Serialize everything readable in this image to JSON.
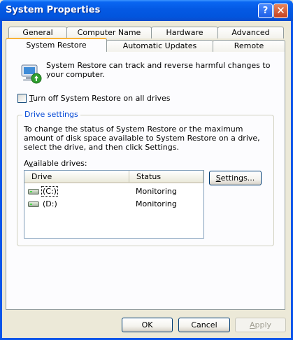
{
  "window": {
    "title": "System Properties",
    "help_glyph": "?",
    "close_glyph": "✕"
  },
  "tabs": {
    "row1": [
      "General",
      "Computer Name",
      "Hardware",
      "Advanced"
    ],
    "row2": [
      "System Restore",
      "Automatic Updates",
      "Remote"
    ],
    "active": "System Restore"
  },
  "content": {
    "description": "System Restore can track and reverse harmful changes to your computer.",
    "turn_off": {
      "label_mnemonic": "T",
      "label_rest": "urn off System Restore on all drives",
      "checked": false
    },
    "group_title": "Drive settings",
    "instructions": "To change the status of System Restore or the maximum amount of disk space available to System Restore on a drive, select the drive, and then click Settings.",
    "available_pre": "A",
    "available_mnemonic": "v",
    "available_rest": "ailable drives:",
    "columns": [
      "Drive",
      "Status"
    ],
    "drives": [
      {
        "name": "(C:)",
        "status": "Monitoring",
        "icon": "hard-drive-icon",
        "selected": true
      },
      {
        "name": "(D:)",
        "status": "Monitoring",
        "icon": "hard-drive-icon",
        "selected": false
      }
    ],
    "settings_mnemonic": "S",
    "settings_rest": "ettings..."
  },
  "buttons": {
    "ok": "OK",
    "cancel": "Cancel",
    "apply_mnemonic": "A",
    "apply_rest": "pply",
    "apply_enabled": false
  },
  "colors": {
    "title_bar": "#0055e5",
    "group_title": "#0046d5",
    "active_tab_accent": "#f9b336",
    "face": "#ece9d8"
  }
}
